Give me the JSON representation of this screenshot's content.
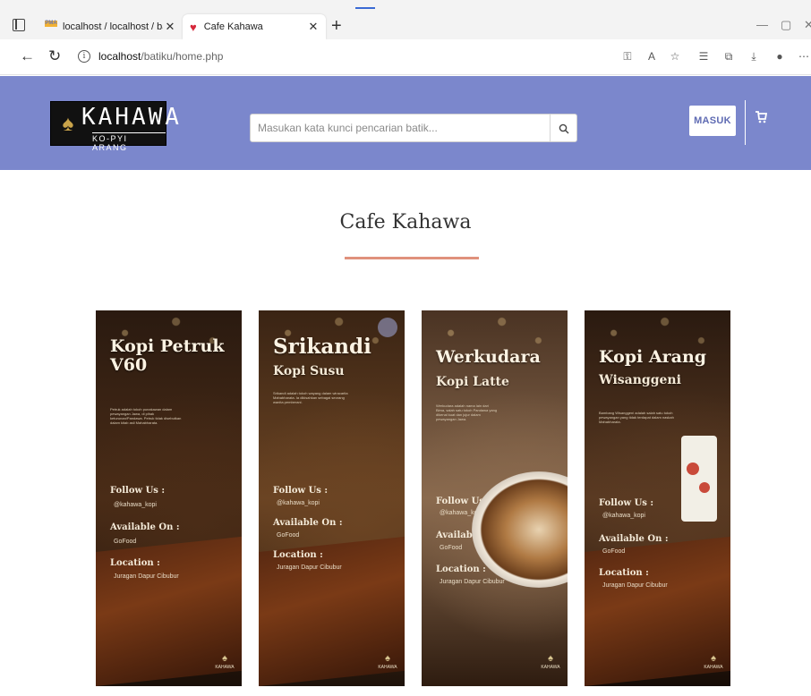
{
  "browser": {
    "tabs": [
      {
        "title": "localhost / localhost / batiku / tɑ",
        "icon": "phpmyadmin-icon"
      },
      {
        "title": "Cafe Kahawa",
        "icon": "heart-icon"
      }
    ],
    "url_host": "localhost",
    "url_path": "/batiku/home.php"
  },
  "header": {
    "logo_word": "KAHAWA",
    "logo_sub": "KO-PYI ARANG",
    "search_placeholder": "Masukan kata kunci pencarian batik...",
    "login_label": "MASUK",
    "colors": {
      "header_bg": "#7b87cc",
      "login_text": "#5f6bb3"
    }
  },
  "page": {
    "title": "Cafe Kahawa",
    "accent": "#e0917c"
  },
  "cards": [
    {
      "name": "Kopi Petruk V60",
      "subtitle": "",
      "description": "Petruk adalah tokoh punakawan dalam pewayangan Jawa, di pihak keturunan/Pandawa. Petruk tidak disebutkan dalam kitab asli Mahabharata.",
      "follow_label": "Follow Us :",
      "follow_value": "@kahawa_kopi",
      "available_label": "Available On :",
      "available_value": "GoFood",
      "location_label": "Location :",
      "location_value": "Juragan Dapur Cibubur",
      "theme": [
        "#2a1a10",
        "#4a2c17",
        "#1a0f08"
      ]
    },
    {
      "name": "Srikandi",
      "subtitle": "Kopi Susu",
      "description": "Srikandi adalah tokoh wayang dalam wiracarita Mahabharata. Ia dikisahkan sebagai seorang wanita pemberani.",
      "follow_label": "Follow Us :",
      "follow_value": "@kahawa_kopi",
      "available_label": "Available On :",
      "available_value": "GoFood",
      "location_label": "Location :",
      "location_value": "Juragan Dapur Cibubur",
      "theme": [
        "#3a2414",
        "#6b4423",
        "#1e120a"
      ]
    },
    {
      "name": "Werkudara",
      "subtitle": "Kopi Latte",
      "description": "Werkudara adalah nama lain dari Bima, salah satu tokoh Pandawa yang dikenal kuat dan jujur dalam pewayangan Jawa.",
      "follow_label": "Follow Us :",
      "follow_value": "@kahawa_kopi",
      "available_label": "Available On :",
      "available_value": "GoFood",
      "location_label": "Location :",
      "location_value": "Juragan Dapur Cibubur",
      "theme": [
        "#4a3323",
        "#8a6a4e",
        "#2e1c10"
      ]
    },
    {
      "name": "Kopi Arang",
      "subtitle": "Wisanggeni",
      "description": "Bambang Wisanggeni adalah salah satu tokoh pewayangan yang tidak terdapat dalam naskah Mahabharata.",
      "follow_label": "Follow Us :",
      "follow_value": "@kahawa_kopi",
      "available_label": "Available On :",
      "available_value": "GoFood",
      "location_label": "Location :",
      "location_value": "Juragan Dapur Cibubur",
      "theme": [
        "#2a1a10",
        "#5a3a22",
        "#160c06"
      ]
    }
  ]
}
